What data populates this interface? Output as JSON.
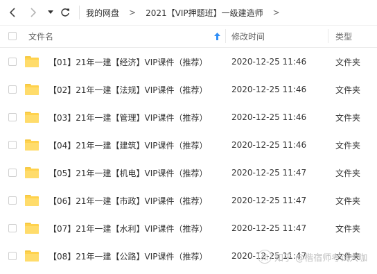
{
  "breadcrumb": {
    "root": "我的网盘",
    "separator": ">",
    "current": "2021【VIP押题班】一级建造师",
    "trailing": ">"
  },
  "columns": {
    "name": "文件名",
    "modified": "修改时间",
    "type": "类型"
  },
  "files": [
    {
      "name": "【01】21年一建【经济】VIP课件（推荐）",
      "modified": "2020-12-25 11:46",
      "type": "文件夹"
    },
    {
      "name": "【02】21年一建【法规】VIP课件（推荐）",
      "modified": "2020-12-25 11:46",
      "type": "文件夹"
    },
    {
      "name": "【03】21年一建【管理】VIP课件（推荐）",
      "modified": "2020-12-25 11:46",
      "type": "文件夹"
    },
    {
      "name": "【04】21年一建【建筑】VIP课件（推荐）",
      "modified": "2020-12-25 11:46",
      "type": "文件夹"
    },
    {
      "name": "【05】21年一建【机电】VIP课件（推荐）",
      "modified": "2020-12-25 11:47",
      "type": "文件夹"
    },
    {
      "name": "【06】21年一建【市政】VIP课件（推荐）",
      "modified": "2020-12-25 11:47",
      "type": "文件夹"
    },
    {
      "name": "【07】21年一建【水利】VIP课件（推荐）",
      "modified": "2020-12-25 11:47",
      "type": "文件夹"
    },
    {
      "name": "【08】21年一建【公路】VIP课件（推荐）",
      "modified": "2020-12-25 11:47",
      "type": "文件夹"
    }
  ],
  "watermark": {
    "logo": "知",
    "text": "知乎 @楷宿师考试大咖"
  },
  "icons": {
    "back": "chevron-left-icon",
    "forward": "chevron-right-icon",
    "history": "dropdown-triangle-icon",
    "refresh": "refresh-icon",
    "sort": "sort-up-arrow-icon",
    "folder": "folder-icon"
  },
  "colors": {
    "sort_arrow": "#2f8ef6",
    "folder": "#ffd24d",
    "text": "#333333",
    "header_text": "#666666"
  }
}
